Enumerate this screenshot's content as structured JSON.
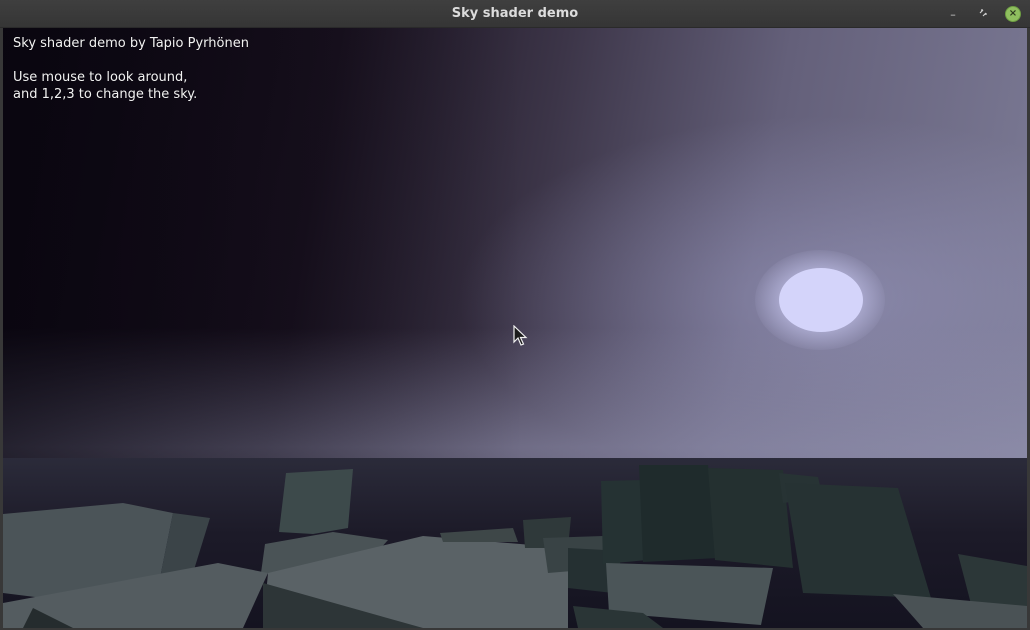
{
  "window": {
    "title": "Sky shader demo",
    "controls": {
      "minimize_icon": "minimize-icon",
      "maximize_icon": "maximize-icon",
      "close_icon": "close-icon"
    }
  },
  "hud": {
    "line1": "Sky shader demo by Tapio Pyrhönen",
    "line2": "Use mouse to look around,",
    "line3": "and 1,2,3 to change the sky."
  },
  "colors": {
    "sky_dark": "#0c0712",
    "sky_light": "#7e7d98",
    "sun": "#d4d4fa",
    "close_button": "#8fbf5f"
  }
}
